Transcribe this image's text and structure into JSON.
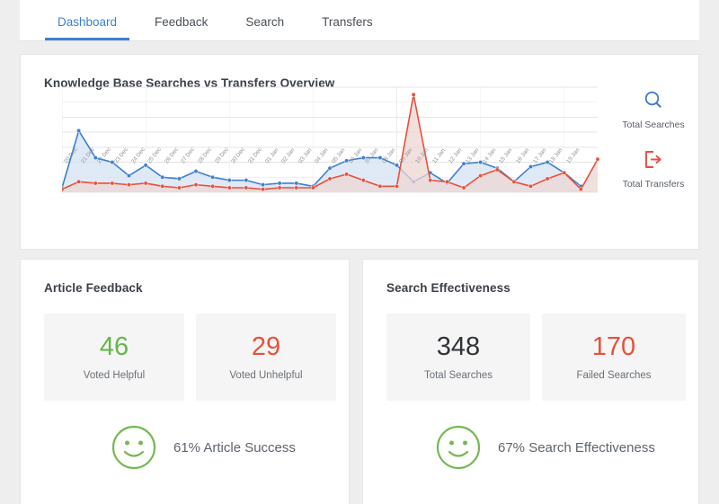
{
  "tabs": [
    {
      "label": "Dashboard",
      "active": true
    },
    {
      "label": "Feedback",
      "active": false
    },
    {
      "label": "Search",
      "active": false
    },
    {
      "label": "Transfers",
      "active": false
    }
  ],
  "chart_card": {
    "title": "Knowledge Base Searches vs Transfers Overview",
    "legend": [
      {
        "icon": "search-icon",
        "label": "Total Searches",
        "color": "#3d7fd0"
      },
      {
        "icon": "transfer-exit-icon",
        "label": "Total Transfers",
        "color": "#e8503a"
      }
    ]
  },
  "chart_data": {
    "type": "area",
    "title": "Knowledge Base Searches vs Transfers Overview",
    "xlabel": "",
    "ylabel": "",
    "ylim": [
      0,
      70
    ],
    "yticks": [
      0,
      10,
      20,
      30,
      40,
      50,
      60,
      70
    ],
    "grid": true,
    "legend_position": "right",
    "categories": [
      "20 Dec",
      "21 Dec",
      "22 Dec",
      "23 Dec",
      "24 Dec",
      "25 Dec",
      "26 Dec",
      "27 Dec",
      "28 Dec",
      "29 Dec",
      "30 Dec",
      "31 Dec",
      "01 Jan",
      "02 Jan",
      "03 Jan",
      "04 Jan",
      "05 Jan",
      "06 Jan",
      "07 Jan",
      "08 Jan",
      "09 Jan",
      "10 Jan",
      "11 Jan",
      "12 Jan",
      "13 Jan",
      "14 Jan",
      "15 Jan",
      "16 Jan",
      "17 Jan",
      "18 Jan",
      "19 Jan"
    ],
    "series": [
      {
        "name": "Total Searches",
        "color": "#3d7fd0",
        "fill": "#d5e3f4",
        "values": [
          3,
          41,
          23,
          20,
          11,
          18,
          10,
          9,
          14,
          10,
          8,
          8,
          5,
          6,
          6,
          4,
          16,
          21,
          23,
          23,
          18,
          7,
          13,
          6,
          19,
          20,
          16,
          7,
          17,
          20,
          13,
          4
        ]
      },
      {
        "name": "Total Transfers",
        "color": "#e8503a",
        "fill": "#eed6d3",
        "values": [
          2,
          7,
          6,
          6,
          5,
          6,
          4,
          3,
          5,
          4,
          3,
          3,
          2,
          3,
          3,
          3,
          9,
          12,
          8,
          4,
          4,
          65,
          8,
          7,
          3,
          11,
          15,
          7,
          4,
          9,
          13,
          2,
          22
        ]
      }
    ]
  },
  "feedback_card": {
    "title": "Article Feedback",
    "tiles": [
      {
        "value": "46",
        "label": "Voted Helpful",
        "color": "#64b74b"
      },
      {
        "value": "29",
        "label": "Voted Unhelpful",
        "color": "#e8503a"
      }
    ],
    "summary": {
      "icon": "smiley-face-icon",
      "text": "61% Article Success",
      "icon_color": "#76b852"
    }
  },
  "effectiveness_card": {
    "title": "Search Effectiveness",
    "tiles": [
      {
        "value": "348",
        "label": "Total Searches",
        "color": "#2f3339"
      },
      {
        "value": "170",
        "label": "Failed Searches",
        "color": "#e8503a"
      }
    ],
    "summary": {
      "icon": "smiley-face-icon",
      "text": "67% Search Effectiveness",
      "icon_color": "#76b852"
    }
  }
}
